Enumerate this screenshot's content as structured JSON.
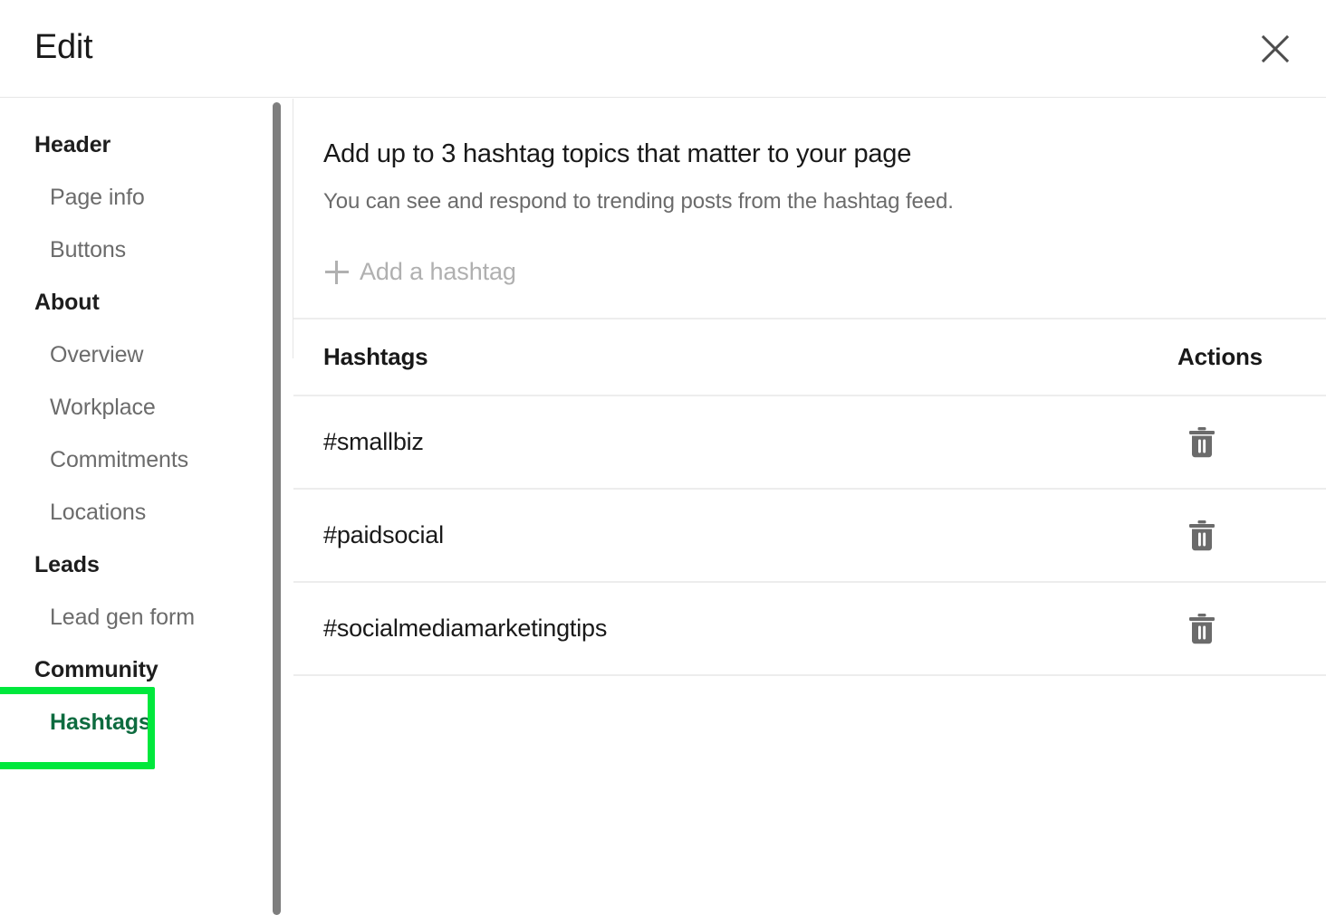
{
  "modal": {
    "title": "Edit",
    "close_icon": "close-icon",
    "close_label": "Close"
  },
  "sidebar": {
    "groups": [
      {
        "section": "Header",
        "items": [
          {
            "label": "Page info",
            "highlighted": false
          },
          {
            "label": "Buttons",
            "highlighted": false
          }
        ]
      },
      {
        "section": "About",
        "items": [
          {
            "label": "Overview",
            "highlighted": false
          },
          {
            "label": "Workplace",
            "highlighted": false
          },
          {
            "label": "Commitments",
            "highlighted": false
          },
          {
            "label": "Locations",
            "highlighted": false
          }
        ]
      },
      {
        "section": "Leads",
        "items": [
          {
            "label": "Lead gen form",
            "highlighted": false
          }
        ]
      },
      {
        "section": "Community",
        "items": [
          {
            "label": "Hashtags",
            "highlighted": true
          }
        ]
      }
    ],
    "scrollbar": {
      "name": "sidebar-scrollbar"
    }
  },
  "main": {
    "heading": "Add up to 3 hashtag topics that matter to your page",
    "subheading": "You can see and respond to trending posts from the hashtag feed.",
    "add_button": {
      "label": "Add a hashtag",
      "icon": "plus-icon",
      "disabled": true
    },
    "table": {
      "columns": [
        "Hashtags",
        "Actions"
      ],
      "rows": [
        {
          "hashtag": "#smallbiz",
          "action_icon": "trash-icon",
          "action_label": "Delete"
        },
        {
          "hashtag": "#paidsocial",
          "action_icon": "trash-icon",
          "action_label": "Delete"
        },
        {
          "hashtag": "#socialmediamarketingtips",
          "action_icon": "trash-icon",
          "action_label": "Delete"
        }
      ]
    }
  },
  "colors": {
    "highlight_border": "#00e83c",
    "highlight_text": "#0d6b3f",
    "text_primary": "#191919",
    "text_muted": "#6b6b6b",
    "text_disabled": "#b0b0b0",
    "divider": "#ededed",
    "scrollbar_thumb": "#7e7e7e"
  }
}
